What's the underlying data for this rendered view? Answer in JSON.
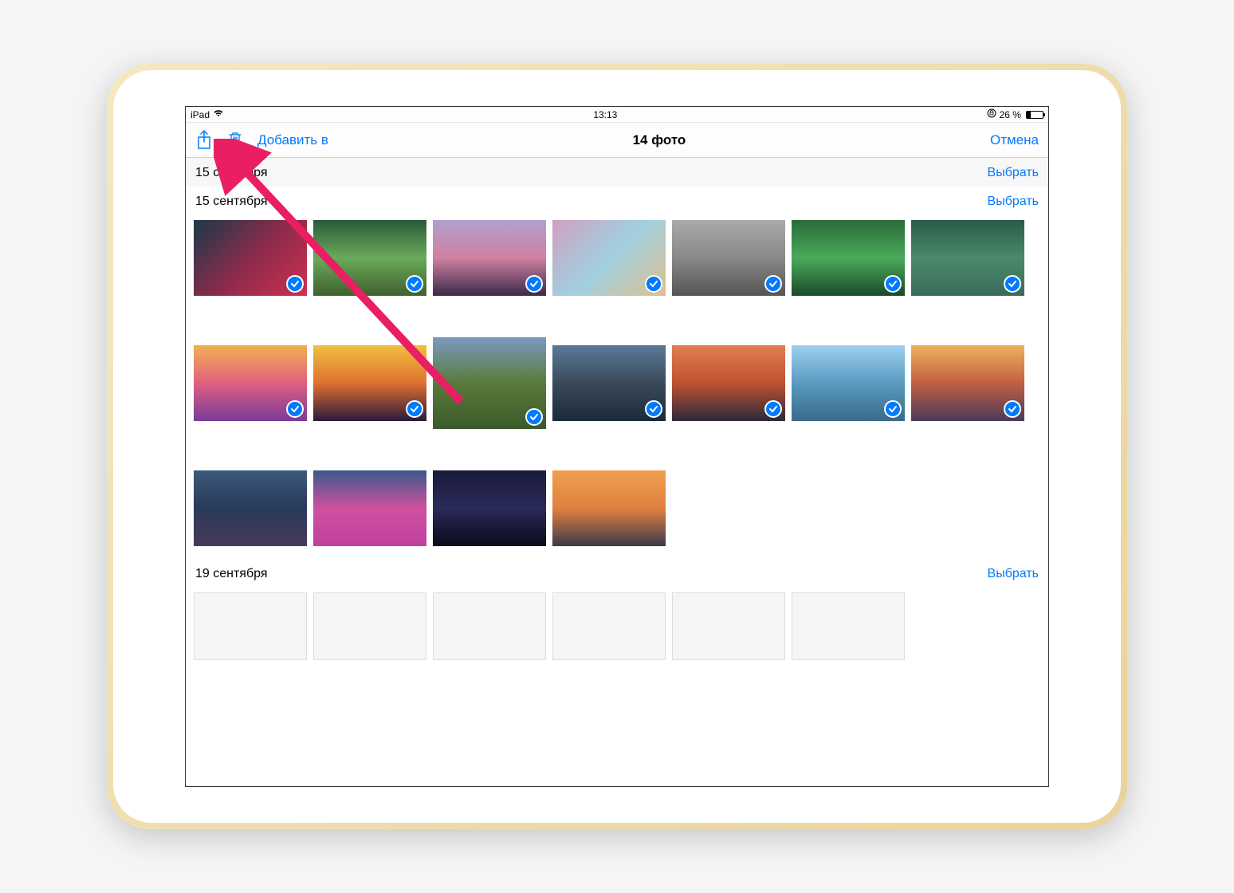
{
  "statusbar": {
    "device": "iPad",
    "time": "13:13",
    "battery_percent": "26 %"
  },
  "toolbar": {
    "add_to": "Добавить в",
    "title": "14 фото",
    "cancel": "Отмена"
  },
  "sections": {
    "s1": {
      "title": "15 сентября",
      "select": "Выбрать"
    },
    "s2": {
      "title": "15 сентября",
      "select": "Выбрать"
    },
    "s3": {
      "title": "19 сентября",
      "select": "Выбрать"
    }
  }
}
